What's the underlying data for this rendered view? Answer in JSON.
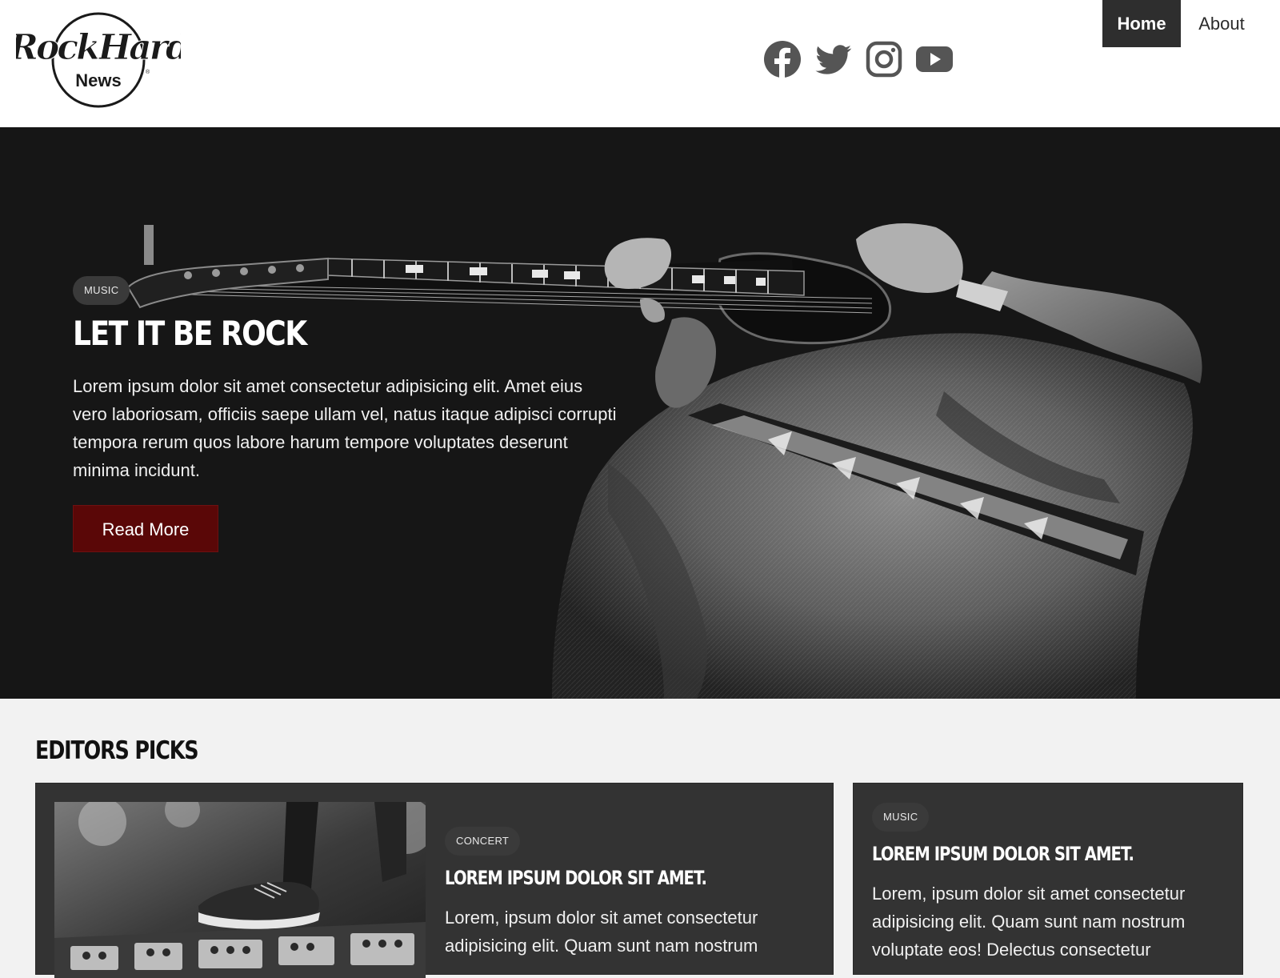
{
  "header": {
    "logo": {
      "line1": "RockHard",
      "line2": "News",
      "mark": "®"
    },
    "social": [
      {
        "name": "facebook",
        "icon": "facebook-icon"
      },
      {
        "name": "twitter",
        "icon": "twitter-icon"
      },
      {
        "name": "instagram",
        "icon": "instagram-icon"
      },
      {
        "name": "youtube",
        "icon": "youtube-icon"
      }
    ],
    "nav": {
      "home": "Home",
      "about": "About"
    }
  },
  "hero": {
    "badge": "MUSIC",
    "title": "LET IT BE ROCK",
    "text": "Lorem ipsum dolor sit amet consectetur adipisicing elit. Amet eius vero laboriosam, officiis saepe ullam vel, natus itaque adipisci corrupti tempora rerum quos labore harum tempore voluptates deserunt minima incidunt.",
    "button": "Read More"
  },
  "editors_picks": {
    "title": "EDITORS PICKS",
    "cards": [
      {
        "badge": "CONCERT",
        "title": "LOREM IPSUM DOLOR SIT AMET.",
        "text": "Lorem, ipsum dolor sit amet consectetur adipisicing elit. Quam sunt nam nostrum"
      },
      {
        "badge": "MUSIC",
        "title": "LOREM IPSUM DOLOR SIT AMET.",
        "text": "Lorem, ipsum dolor sit amet consectetur adipisicing elit. Quam sunt nam nostrum voluptate eos! Delectus consectetur"
      }
    ]
  },
  "colors": {
    "accent": "#5a0707",
    "dark": "#161616",
    "card": "#333333"
  }
}
